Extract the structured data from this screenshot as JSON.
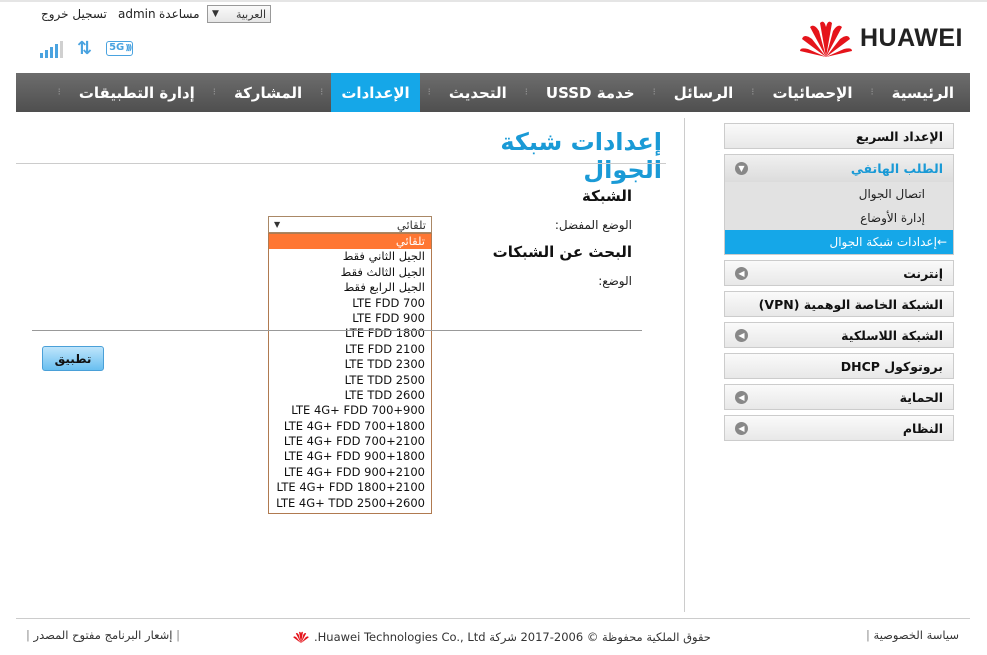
{
  "header": {
    "language": "العربية",
    "help": "مساعدة",
    "user": "admin",
    "logout": "تسجيل خروج",
    "brand": "HUAWEI",
    "network_type": "5G"
  },
  "nav": {
    "items": [
      {
        "label": "الرئيسية",
        "active": false
      },
      {
        "label": "الإحصائيات",
        "active": false
      },
      {
        "label": "الرسائل",
        "active": false
      },
      {
        "label": "خدمة USSD",
        "active": false
      },
      {
        "label": "التحديث",
        "active": false
      },
      {
        "label": "الإعدادات",
        "active": true
      },
      {
        "label": "المشاركة",
        "active": false
      },
      {
        "label": "إدارة التطبيقات",
        "active": false
      }
    ]
  },
  "sidebar": {
    "quick_setup": "الإعداد السريع",
    "dialup": {
      "label": "الطلب الهاتفي",
      "subitems": [
        "اتصال الجوال",
        "إدارة الأوضاع",
        "إعدادات شبكة الجوال"
      ]
    },
    "internet": "إنترنت",
    "vpn": "الشبكة الخاصة الوهمية (VPN)",
    "wlan": "الشبكة اللاسلكية",
    "dhcp": "بروتوكول DHCP",
    "security": "الحماية",
    "system": "النظام"
  },
  "content": {
    "title": "إعدادات شبكة الجوال",
    "network_section": "الشبكة",
    "preferred_mode_label": "الوضع المفضل:",
    "preferred_mode_value": "تلقائي",
    "search_section": "البحث عن الشبكات",
    "mode_label": "الوضع:",
    "apply": "تطبيق",
    "options": [
      "تلقائي",
      "الجيل الثاني فقط",
      "الجيل الثالث فقط",
      "الجيل الرابع فقط",
      "LTE FDD 700",
      "LTE FDD 900",
      "LTE FDD 1800",
      "LTE FDD 2100",
      "LTE TDD 2300",
      "LTE TDD 2500",
      "LTE TDD 2600",
      "LTE 4G+ FDD 700+900",
      "LTE 4G+ FDD 700+1800",
      "LTE 4G+ FDD 700+2100",
      "LTE 4G+ FDD 900+1800",
      "LTE 4G+ FDD 900+2100",
      "LTE 4G+ FDD 1800+2100",
      "LTE 4G+ TDD 2500+2600"
    ]
  },
  "footer": {
    "open_source": "إشعار البرنامج مفتوح المصدر",
    "copyright": "حقوق الملكية محفوظة © 2006-2017 شركة Huawei Technologies Co., Ltd.",
    "privacy": "سياسة الخصوصية"
  }
}
